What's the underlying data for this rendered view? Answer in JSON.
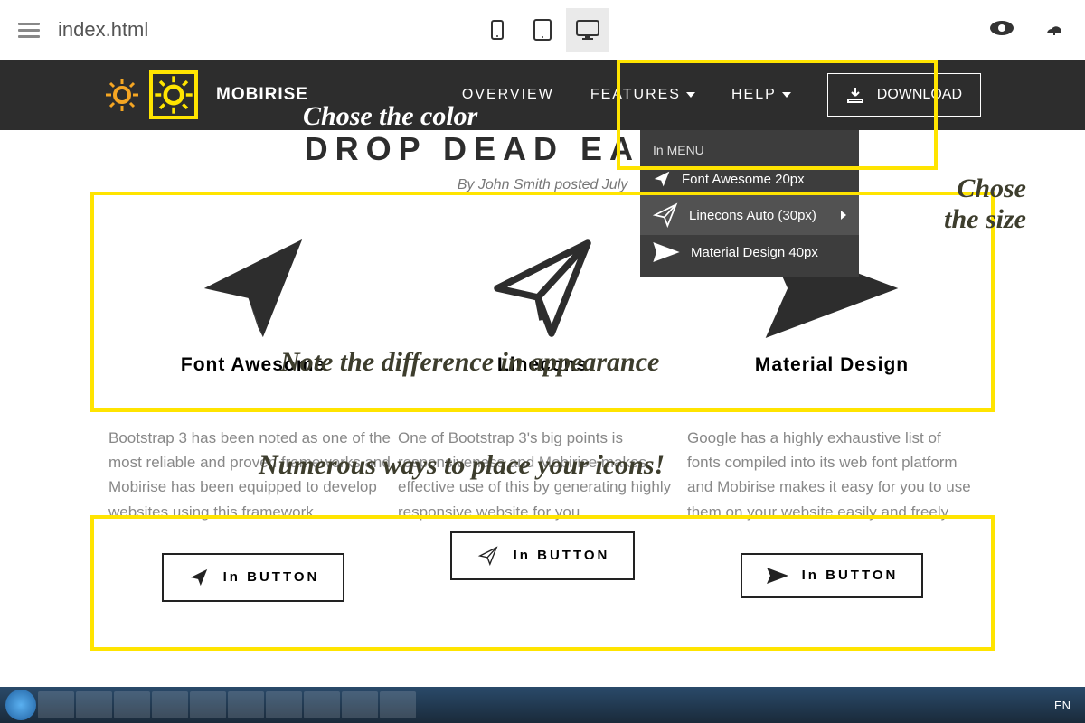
{
  "top": {
    "filename": "index.html"
  },
  "nav": {
    "brand": "MOBIRISE",
    "overview": "OVERVIEW",
    "features": "FEATURES",
    "help": "HELP",
    "download": "DOWNLOAD"
  },
  "dropdown": {
    "header": "In MENU",
    "item1": "Font Awesome 20px",
    "item2": "Linecons Auto (30px)",
    "item3": "Material Design 40px"
  },
  "content": {
    "headline": "DROP DEAD EASY WE",
    "byline": "By John Smith posted July",
    "col1": {
      "title": "Font Awesome",
      "desc": "Bootstrap 3 has been noted as one of the most reliable and proven frameworks and Mobirise has been equipped to develop websites using this framework.",
      "btn": "In BUTTON"
    },
    "col2": {
      "title": "Linecons",
      "desc": "One of Bootstrap 3's big points is responsiveness and Mobirise makes effective use of this by generating highly responsive website for you.",
      "btn": "In BUTTON"
    },
    "col3": {
      "title": "Material Design",
      "desc": "Google has a highly exhaustive list of fonts compiled into its web font platform and Mobirise makes it easy for you to use them on your website easily and freely.",
      "btn": "In BUTTON"
    }
  },
  "annotations": {
    "color": "Chose the color",
    "size1": "Chose",
    "size2": "the size",
    "diff": "Note the difference in appearance",
    "ways": "Numerous ways to place your icons!"
  },
  "taskbar": {
    "lang": "EN"
  }
}
